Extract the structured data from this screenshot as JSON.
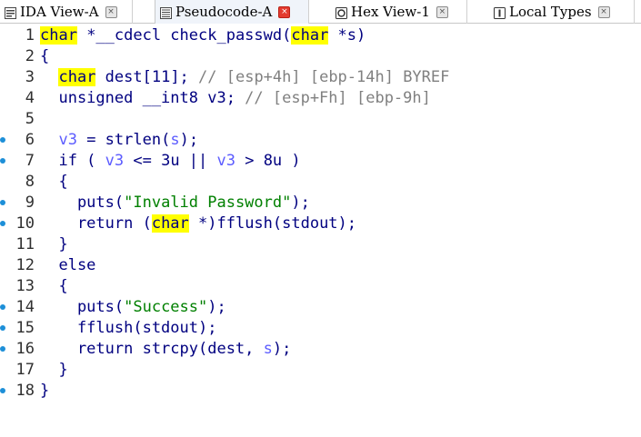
{
  "tabs": [
    {
      "label": "IDA View-A",
      "active": false,
      "icon": "ida-view-icon"
    },
    {
      "label": "Pseudocode-A",
      "active": true,
      "icon": "pseudocode-icon"
    },
    {
      "label": "Hex View-1",
      "active": false,
      "icon": "hex-view-icon"
    },
    {
      "label": "Local Types",
      "active": false,
      "icon": "local-types-icon"
    }
  ],
  "close_glyph": "×",
  "lines": [
    {
      "n": "1",
      "bp": false,
      "segs": [
        [
          "hl",
          "char"
        ],
        [
          "plain",
          " *__cdecl check_passwd("
        ],
        [
          "hl",
          "char"
        ],
        [
          "plain",
          " *s)"
        ]
      ]
    },
    {
      "n": "2",
      "bp": false,
      "segs": [
        [
          "plain",
          "{"
        ]
      ]
    },
    {
      "n": "3",
      "bp": false,
      "segs": [
        [
          "plain",
          "  "
        ],
        [
          "hl",
          "char"
        ],
        [
          "plain",
          " dest[11]; "
        ],
        [
          "cmt",
          "// [esp+4h] [ebp-14h] BYREF"
        ]
      ]
    },
    {
      "n": "4",
      "bp": false,
      "segs": [
        [
          "plain",
          "  unsigned __int8 v3; "
        ],
        [
          "cmt",
          "// [esp+Fh] [ebp-9h]"
        ]
      ]
    },
    {
      "n": "5",
      "bp": false,
      "segs": [
        [
          "plain",
          ""
        ]
      ]
    },
    {
      "n": "6",
      "bp": true,
      "segs": [
        [
          "plain",
          "  "
        ],
        [
          "var",
          "v3"
        ],
        [
          "plain",
          " = strlen("
        ],
        [
          "var",
          "s"
        ],
        [
          "plain",
          ");"
        ]
      ]
    },
    {
      "n": "7",
      "bp": true,
      "segs": [
        [
          "plain",
          "  if ( "
        ],
        [
          "var",
          "v3"
        ],
        [
          "plain",
          " <= 3u || "
        ],
        [
          "var",
          "v3"
        ],
        [
          "plain",
          " > 8u )"
        ]
      ]
    },
    {
      "n": "8",
      "bp": false,
      "segs": [
        [
          "plain",
          "  {"
        ]
      ]
    },
    {
      "n": "9",
      "bp": true,
      "segs": [
        [
          "plain",
          "    puts("
        ],
        [
          "str",
          "\"Invalid Password\""
        ],
        [
          "plain",
          ");"
        ]
      ]
    },
    {
      "n": "10",
      "bp": true,
      "segs": [
        [
          "plain",
          "    return ("
        ],
        [
          "hl",
          "char"
        ],
        [
          "plain",
          " *)fflush(stdout);"
        ]
      ]
    },
    {
      "n": "11",
      "bp": false,
      "segs": [
        [
          "plain",
          "  }"
        ]
      ]
    },
    {
      "n": "12",
      "bp": false,
      "segs": [
        [
          "plain",
          "  else"
        ]
      ]
    },
    {
      "n": "13",
      "bp": false,
      "segs": [
        [
          "plain",
          "  {"
        ]
      ]
    },
    {
      "n": "14",
      "bp": true,
      "segs": [
        [
          "plain",
          "    puts("
        ],
        [
          "str",
          "\"Success\""
        ],
        [
          "plain",
          ");"
        ]
      ]
    },
    {
      "n": "15",
      "bp": true,
      "segs": [
        [
          "plain",
          "    fflush(stdout);"
        ]
      ]
    },
    {
      "n": "16",
      "bp": true,
      "segs": [
        [
          "plain",
          "    return strcpy(dest, "
        ],
        [
          "var",
          "s"
        ],
        [
          "plain",
          ");"
        ]
      ]
    },
    {
      "n": "17",
      "bp": false,
      "segs": [
        [
          "plain",
          "  }"
        ]
      ]
    },
    {
      "n": "18",
      "bp": true,
      "segs": [
        [
          "plain",
          "}"
        ]
      ]
    }
  ],
  "colors": {
    "highlight": "#ffff00",
    "keyword": "#000080",
    "variable": "#5c5cff",
    "comment": "#808080",
    "string": "#008000",
    "breakpoint_dot": "#1d8fd8"
  }
}
